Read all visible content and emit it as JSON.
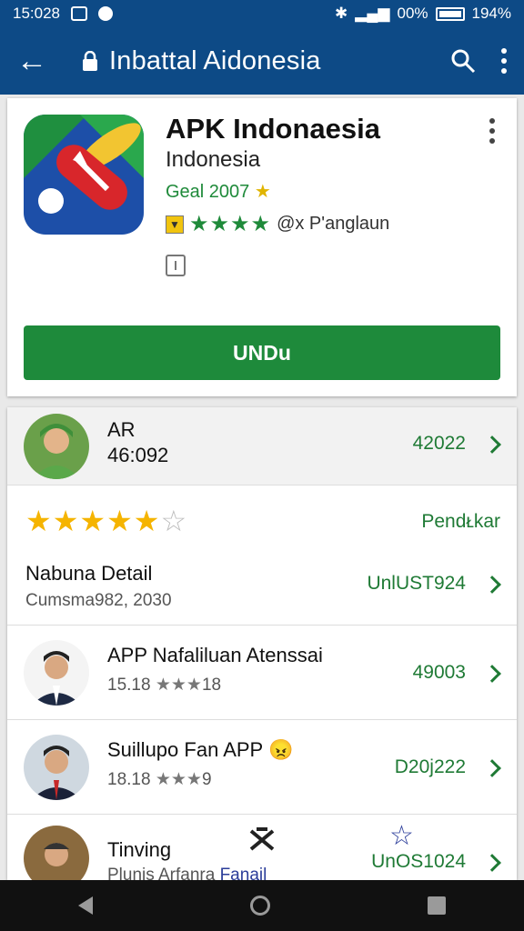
{
  "status_bar": {
    "time": "15:028",
    "battery_text": "00%",
    "battery_level": "194%"
  },
  "app_bar": {
    "title": "Inbattal Aidonesia"
  },
  "app": {
    "name": "APK Indonaesia",
    "developer": "Indonesia",
    "tag": "Geal 2007",
    "rating_label": "@x P'anglaun",
    "install_label": "UNDu"
  },
  "list": {
    "header": {
      "title": "AR",
      "subtitle": "46:092",
      "value": "42022"
    },
    "rating_row": {
      "right_label": "Pendᴌkar",
      "title": "Nabuna Detail",
      "subtitle": "Cumsma982, 2030",
      "value": "UnlUST924"
    },
    "items": [
      {
        "title": "APP Nafaliluan Atenssai",
        "sub_num1": "15.18",
        "sub_num2": "18",
        "value": "49003"
      },
      {
        "title": "Suillupo Fan APP",
        "sub_num1": "18.18",
        "sub_num2": "9",
        "value": "D20j222"
      },
      {
        "title": "Tinving",
        "subtitle": "Plunis Arfanra",
        "subtitle_extra": "Fanail",
        "value": "UnOS1024"
      }
    ]
  },
  "colors": {
    "primary": "#0d4a86",
    "accent": "#1e8a3b",
    "star": "#f5b400"
  }
}
